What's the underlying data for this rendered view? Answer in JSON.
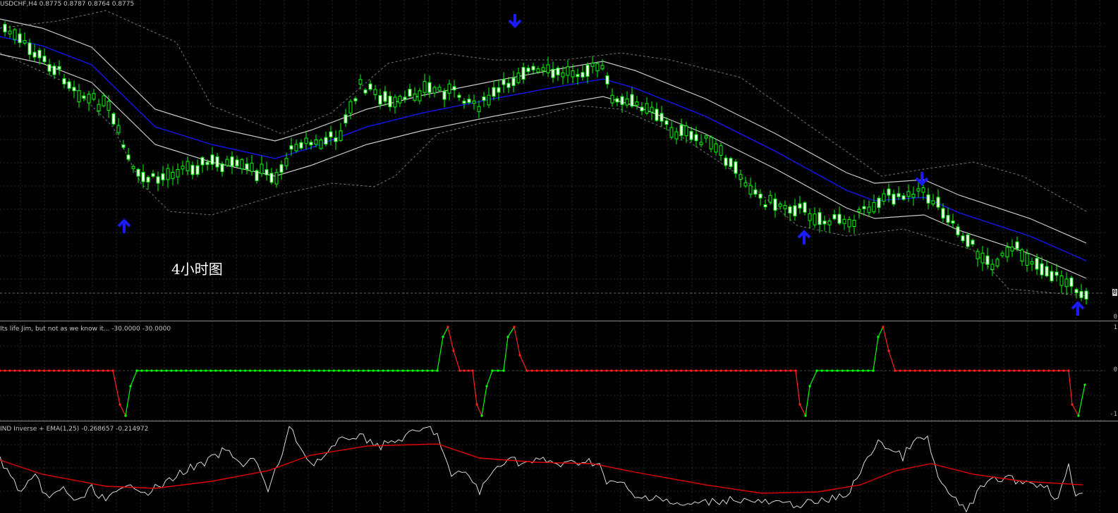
{
  "main": {
    "header": "USDCHF,H4  0.8775 0.8787 0.8764 0.8775",
    "annotation": "4小时图",
    "y_ticks": [
      "0",
      "0"
    ],
    "price_box": "0",
    "colors": {
      "bull": "#00ff00",
      "bear_body": "#ffffff",
      "band": "#c8c8c8",
      "mid": "#1616ff",
      "outer": "#8a8a8a",
      "arrow": "#1a1aff"
    },
    "arrow_up_icon": "arrow-up-icon",
    "arrow_down_icon": "arrow-down-icon"
  },
  "indicator1": {
    "header": "Its life Jim, but not as we know it...  -30.0000 -30.0000",
    "y_ticks": [
      "1",
      "0",
      "-1"
    ],
    "colors": {
      "up": "#00ff00",
      "down": "#ff2020"
    }
  },
  "indicator2": {
    "header": "IND Inverse + EMA(1,25)  -0.268657 -0.214972",
    "colors": {
      "osc": "#d8d8d8",
      "ema": "#e00000"
    }
  }
}
